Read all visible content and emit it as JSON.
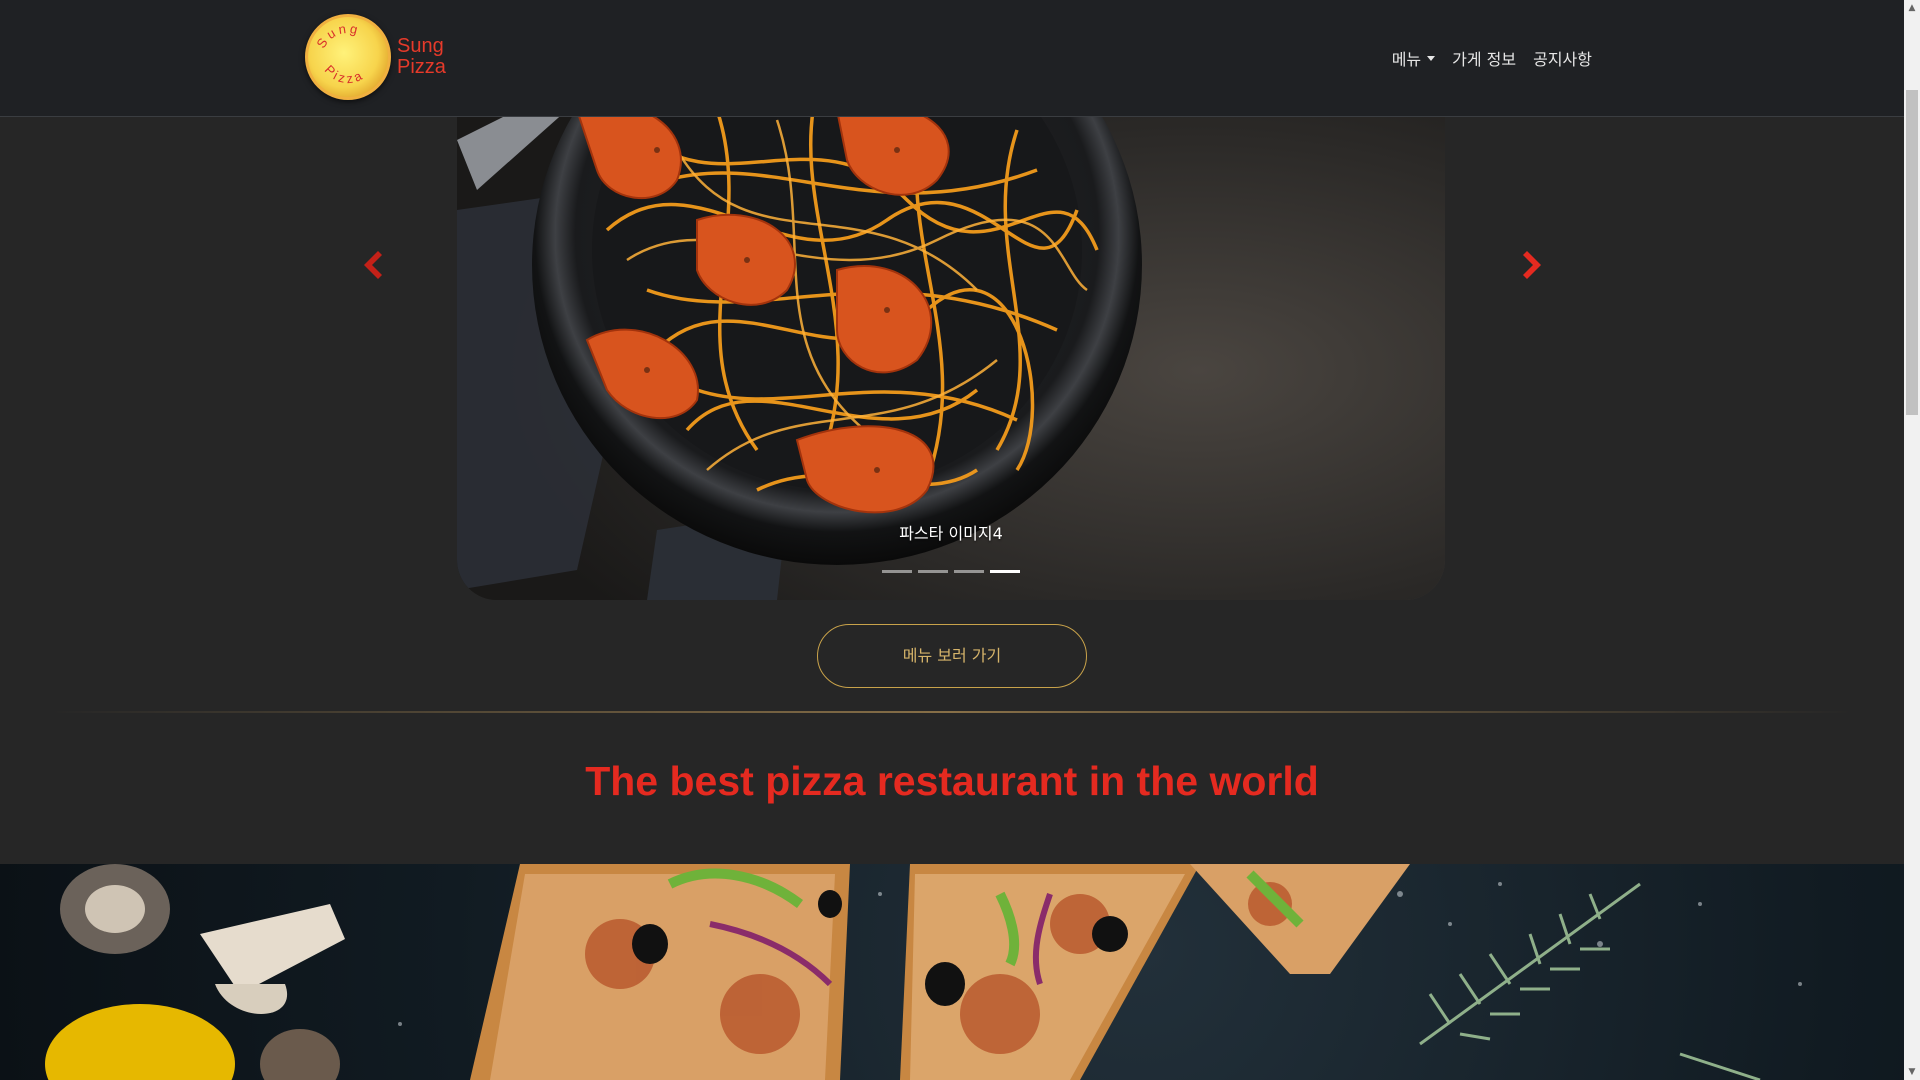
{
  "brand": {
    "name_line1": "Sung",
    "name_line2": "Pizza",
    "badge_text_top": "Sung",
    "badge_text_bottom": "Pizza"
  },
  "nav": {
    "items": [
      {
        "label": "메뉴",
        "has_dropdown": true
      },
      {
        "label": "가게 정보"
      },
      {
        "label": "공지사항"
      }
    ]
  },
  "carousel": {
    "caption": "파스타 이미지4",
    "slide_count": 4,
    "active_index": 3,
    "prev_icon": "chevron-left-icon",
    "next_icon": "chevron-right-icon",
    "arrow_color": "#e52a20"
  },
  "cta": {
    "label": "메뉴 보러 가기"
  },
  "headline": "The best pizza restaurant in the world",
  "colors": {
    "accent": "#e52a20",
    "gold": "#c8a24a",
    "nav_bg": "#1f2124",
    "page_bg": "#262626"
  }
}
